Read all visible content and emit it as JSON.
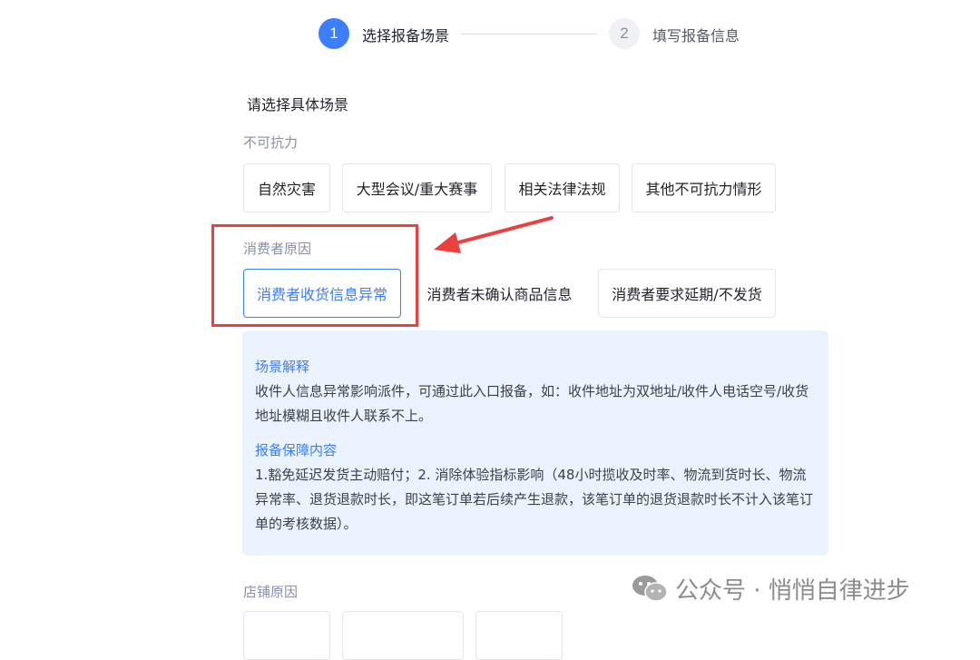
{
  "steps": [
    {
      "number": "1",
      "label": "选择报备场景",
      "active": true
    },
    {
      "number": "2",
      "label": "填写报备信息",
      "active": false
    }
  ],
  "section_title": "请选择具体场景",
  "groups": {
    "force_majeure": {
      "title": "不可抗力",
      "options": [
        "自然灾害",
        "大型会议/重大赛事",
        "相关法律法规",
        "其他不可抗力情形"
      ]
    },
    "consumer": {
      "title": "消费者原因",
      "options": [
        "消费者收货信息异常",
        "消费者未确认商品信息",
        "消费者要求延期/不发货"
      ],
      "selected": "消费者收货信息异常"
    },
    "store": {
      "title": "店铺原因"
    }
  },
  "info": {
    "scene_heading": "场景解释",
    "scene_text": "收件人信息异常影响派件，可通过此入口报备，如：收件地址为双地址/收件人电话空号/收货地址模糊且收件人联系不上。",
    "guarantee_heading": "报备保障内容",
    "guarantee_text": "1.豁免延迟发货主动赔付；2. 消除体验指标影响（48小时揽收及时率、物流到货时长、物流异常率、退货退款时长，即这笔订单若后续产生退款，该笔订单的退货退款时长不计入该笔订单的考核数据）。"
  },
  "watermark": "公众号 · 悄悄自律进步",
  "colors": {
    "accent": "#3d7eff",
    "annotation": "#ee3f3f",
    "info_bg": "#ebf3ff"
  },
  "icons": {
    "watermark": "wechat-icon",
    "annotation": "arrow-icon"
  }
}
